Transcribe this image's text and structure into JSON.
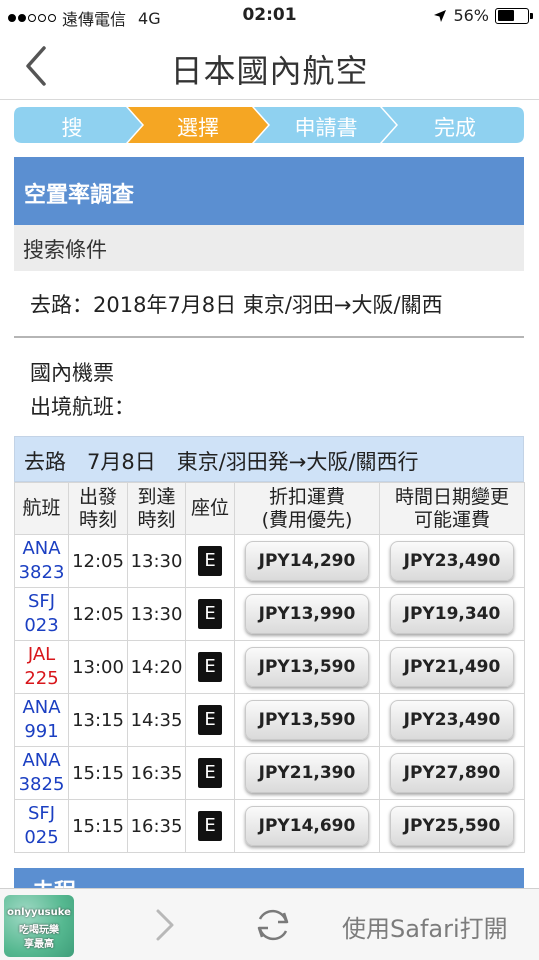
{
  "status_bar": {
    "carrier": "遠傳電信",
    "network": "4G",
    "time": "02:01",
    "battery": "56%",
    "battery_level": 0.56
  },
  "nav": {
    "title": "日本國內航空"
  },
  "steps": [
    "搜",
    "選擇",
    "申請書",
    "完成"
  ],
  "colors": {
    "step_inactive": "#8fd1f0",
    "step_active": "#f5a623",
    "section_header": "#5b8fd1"
  },
  "section": {
    "title": "空置率調查",
    "search_conditions_label": "搜索條件",
    "route": "去路：2018年7月8日 東京/羽田→大阪/關西",
    "ticket_type": "國內機票",
    "international_label": "出境航班："
  },
  "flight_table": {
    "title": "去路　7月8日　東京/羽田発→大阪/關西行",
    "headers": [
      [
        "航班"
      ],
      [
        "出發",
        "時刻"
      ],
      [
        "到達",
        "時刻"
      ],
      [
        "座位"
      ],
      [
        "折扣運費",
        "(費用優先)"
      ],
      [
        "時間日期變更",
        "可能運費"
      ]
    ],
    "rows": [
      {
        "airline": "ANA",
        "number": "3823",
        "color": "blue",
        "depart": "12:05",
        "arrive": "13:30",
        "seat": "E",
        "fare_discount": "JPY14,290",
        "fare_flexible": "JPY23,490"
      },
      {
        "airline": "SFJ",
        "number": "023",
        "color": "blue",
        "depart": "12:05",
        "arrive": "13:30",
        "seat": "E",
        "fare_discount": "JPY13,990",
        "fare_flexible": "JPY19,340"
      },
      {
        "airline": "JAL",
        "number": "225",
        "color": "red",
        "depart": "13:00",
        "arrive": "14:20",
        "seat": "E",
        "fare_discount": "JPY13,590",
        "fare_flexible": "JPY21,490"
      },
      {
        "airline": "ANA",
        "number": "991",
        "color": "blue",
        "depart": "13:15",
        "arrive": "14:35",
        "seat": "E",
        "fare_discount": "JPY13,590",
        "fare_flexible": "JPY23,490"
      },
      {
        "airline": "ANA",
        "number": "3825",
        "color": "blue",
        "depart": "15:15",
        "arrive": "16:35",
        "seat": "E",
        "fare_discount": "JPY21,390",
        "fare_flexible": "JPY27,890"
      },
      {
        "airline": "SFJ",
        "number": "025",
        "color": "blue",
        "depart": "15:15",
        "arrive": "16:35",
        "seat": "E",
        "fare_discount": "JPY14,690",
        "fare_flexible": "JPY25,590"
      }
    ]
  },
  "next_section_peek": "去程",
  "bottom_bar": {
    "open_in_safari": "使用Safari打開",
    "watermark_lines": [
      "onlyyusuke",
      "吃喝玩樂",
      "享最高"
    ]
  }
}
